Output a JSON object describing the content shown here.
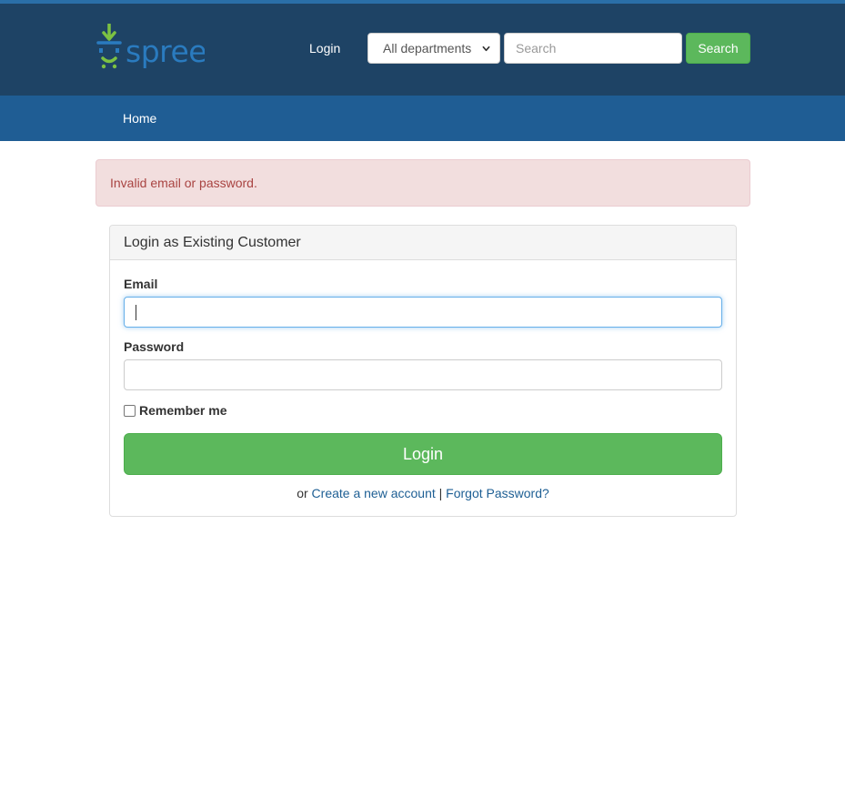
{
  "header": {
    "logo_text": "spree",
    "login_link": "Login",
    "department_select": {
      "selected": "All departments"
    },
    "search": {
      "placeholder": "Search",
      "button_label": "Search"
    }
  },
  "nav": {
    "home": "Home"
  },
  "alert": {
    "message": "Invalid email or password."
  },
  "login_panel": {
    "title": "Login as Existing Customer",
    "email_label": "Email",
    "email_value": "",
    "password_label": "Password",
    "password_value": "",
    "remember_label": "Remember me",
    "remember_checked": false,
    "submit_label": "Login",
    "links": {
      "prefix": "or",
      "create_account": "Create a new account",
      "separator": "|",
      "forgot_password": "Forgot Password?"
    }
  },
  "colors": {
    "header_bg": "#1e4365",
    "navbar_bg": "#1f5d94",
    "accent_green": "#5cb85c",
    "logo_blue": "#2a7bbf",
    "logo_green": "#7cc242",
    "alert_bg": "#f2dede",
    "alert_text": "#a94442",
    "link": "#1e5f94"
  }
}
